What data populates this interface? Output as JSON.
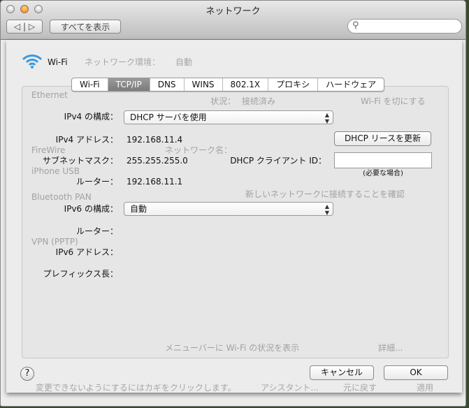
{
  "window": {
    "title": "ネットワーク",
    "show_all": "すべてを表示",
    "search_placeholder": ""
  },
  "background": {
    "location_label": "ネットワーク環境：",
    "location_value": "自動",
    "services": [
      "Ethernet",
      "FireWire",
      "iPhone USB",
      "Bluetooth PAN",
      "VPN (PPTP)"
    ],
    "status_label": "状況：",
    "status_value": "接続済み",
    "wifi_off": "Wi-Fi を切にする",
    "network_name": "ネットワーク名：",
    "ask_join": "新しいネットワークに接続することを確認",
    "show_menu": "メニューバーに Wi-Fi の状況を表示",
    "advanced": "詳細...",
    "lock_text": "変更できないようにするにはカギをクリックします。",
    "assistant": "アシスタント...",
    "revert": "元に戻す",
    "apply": "適用"
  },
  "sheet": {
    "service_name": "Wi-Fi",
    "tabs": [
      "Wi-Fi",
      "TCP/IP",
      "DNS",
      "WINS",
      "802.1X",
      "プロキシ",
      "ハードウェア"
    ],
    "selected_tab": "TCP/IP",
    "ipv4_config_label": "IPv4 の構成：",
    "ipv4_config_value": "DHCP サーバを使用",
    "ipv4_address_label": "IPv4 アドレス：",
    "ipv4_address": "192.168.11.4",
    "renew_button": "DHCP リースを更新",
    "subnet_label": "サブネットマスク：",
    "subnet": "255.255.255.0",
    "client_id_label": "DHCP クライアント ID：",
    "client_id_value": "",
    "client_id_hint": "(必要な場合)",
    "router_label": "ルーター：",
    "router": "192.168.11.1",
    "ipv6_config_label": "IPv6 の構成：",
    "ipv6_config_value": "自動",
    "ipv6_router_label": "ルーター：",
    "ipv6_address_label": "IPv6 アドレス：",
    "prefix_label": "プレフィックス長：",
    "cancel": "キャンセル",
    "ok": "OK",
    "help": "?"
  }
}
